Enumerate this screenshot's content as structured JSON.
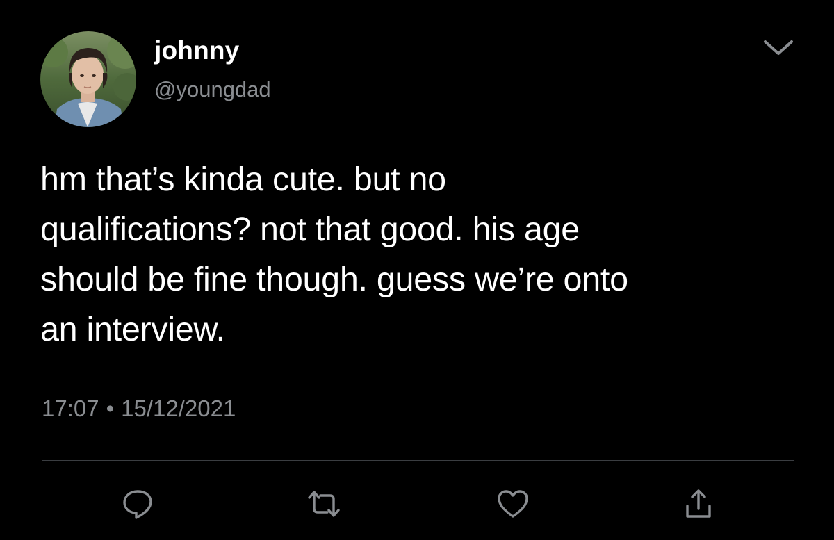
{
  "user": {
    "display_name": "johnny",
    "handle": "@youngdad"
  },
  "tweet": {
    "lines": [
      "hm that’s kinda cute. but no",
      "qualifications? not that good. his age",
      "should be fine though. guess we’re onto",
      "an interview."
    ],
    "time": "17:07",
    "separator": "•",
    "date": "15/12/2021"
  },
  "icons": {
    "more": "chevron-down-icon",
    "reply": "reply-icon",
    "retweet": "retweet-icon",
    "like": "heart-icon",
    "share": "share-icon"
  },
  "colors": {
    "background": "#000000",
    "text": "#ffffff",
    "muted": "#8a8d91",
    "divider": "#3a3d41"
  }
}
